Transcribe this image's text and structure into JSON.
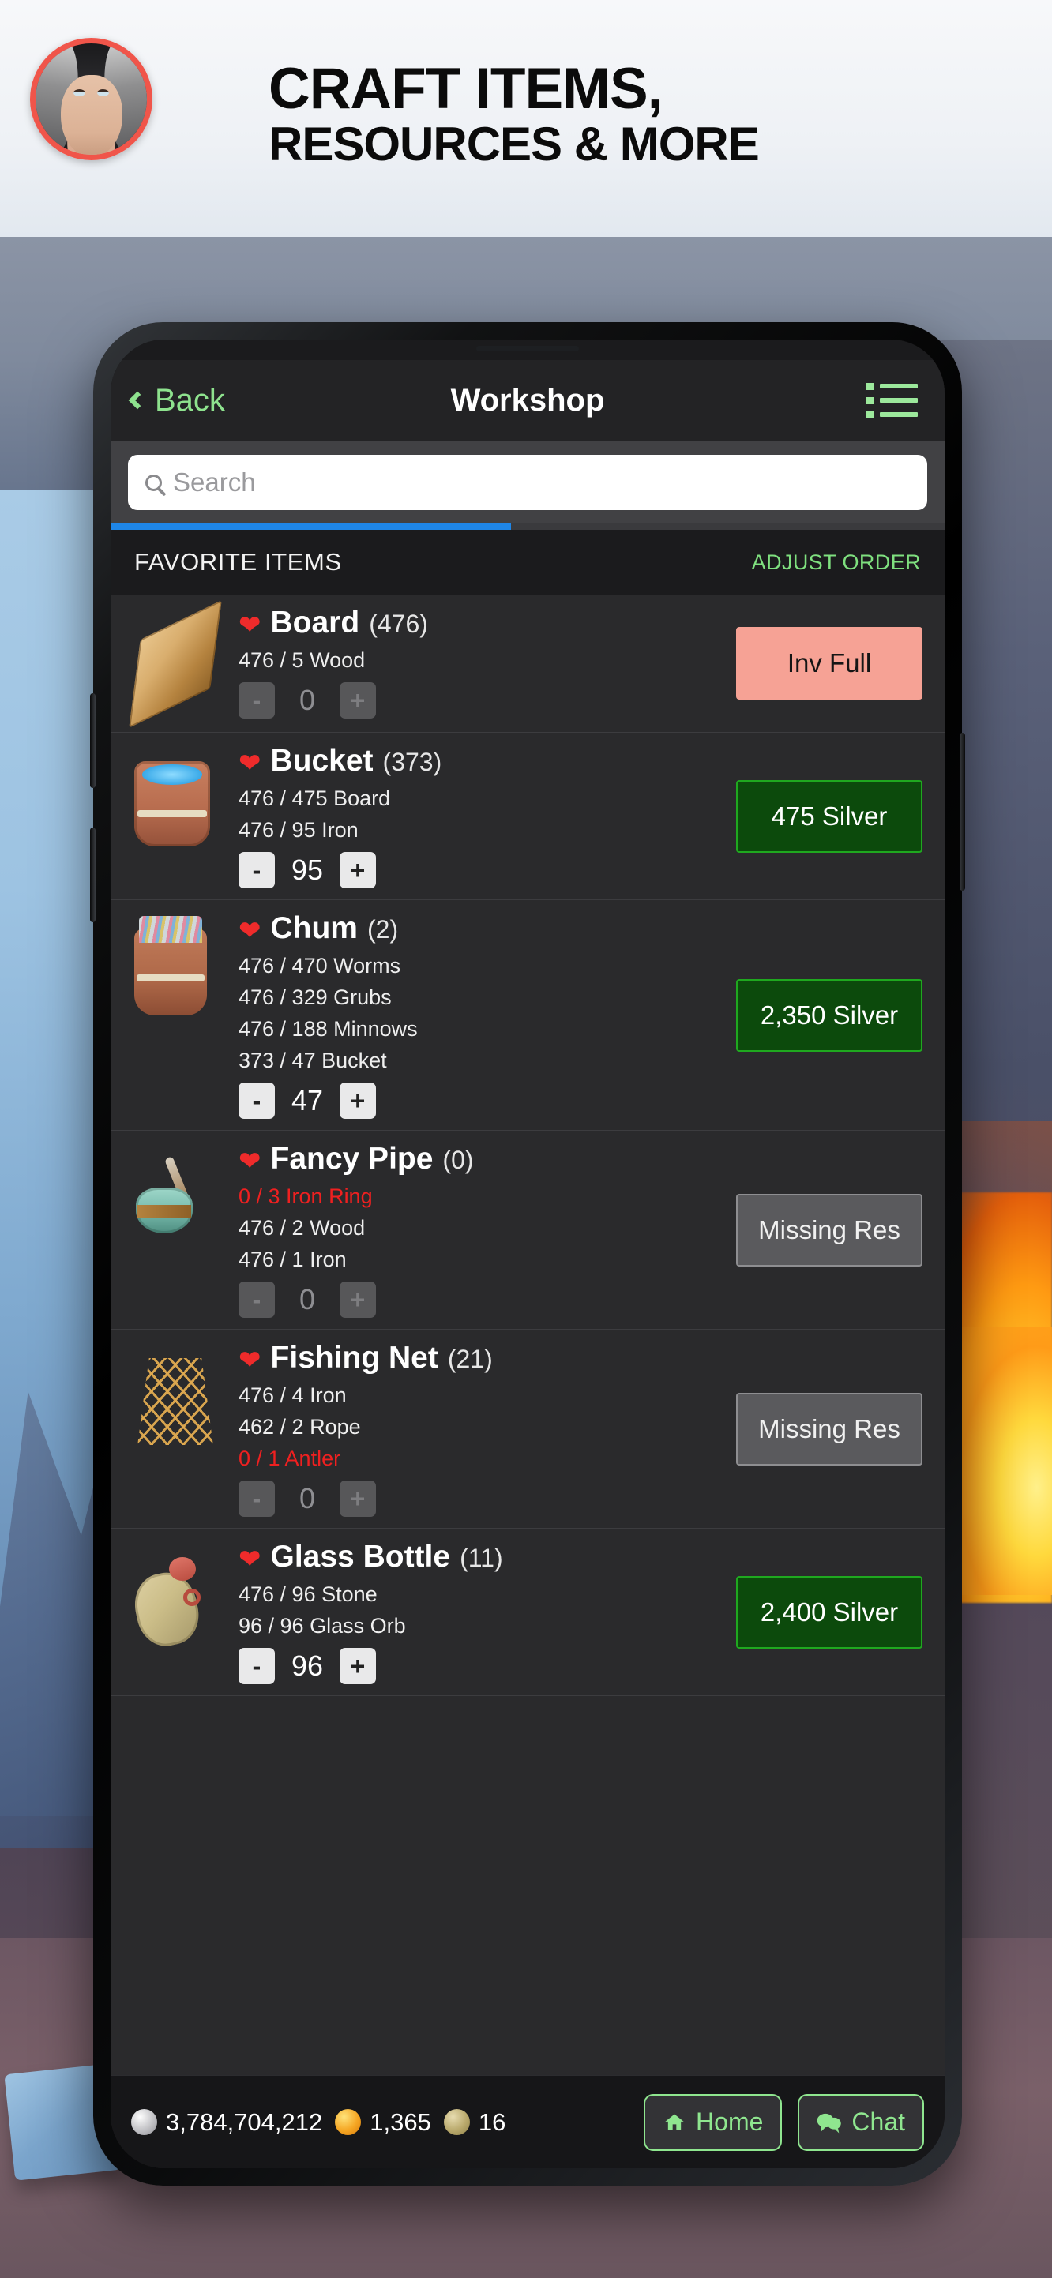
{
  "promo": {
    "headline_line1": "CRAFT ITEMS,",
    "headline_line2": "RESOURCES & MORE",
    "avatar_name": "character-portrait"
  },
  "nav": {
    "back_label": "Back",
    "title": "Workshop",
    "menu_icon": "list-icon"
  },
  "search": {
    "placeholder": "Search",
    "value": "",
    "icon": "search-icon"
  },
  "progress": {
    "percent": 48
  },
  "section": {
    "title": "FAVORITE ITEMS",
    "action_label": "ADJUST ORDER"
  },
  "colors": {
    "accent_green": "#8fe68f",
    "buy_green_bg": "#0c4a0c",
    "buy_green_border": "#1fa81f",
    "inv_full_bg": "#f6a295",
    "missing_bg": "#5a5a5d",
    "missing_text_red": "#ef2020",
    "progress_blue": "#1e86e8",
    "heart_red": "#ef2b2b",
    "promo_accent": "#f0554a"
  },
  "items": [
    {
      "sprite": "board-sprite",
      "favorite_icon": "heart-icon",
      "name": "Board",
      "count": "(476)",
      "requirements": [
        {
          "text": "476 / 5 Wood",
          "missing": false
        }
      ],
      "stepper": {
        "minus": "-",
        "value": "0",
        "plus": "+",
        "enabled": false
      },
      "action": {
        "label": "Inv Full",
        "style": "full"
      }
    },
    {
      "sprite": "bucket-sprite",
      "favorite_icon": "heart-icon",
      "name": "Bucket",
      "count": "(373)",
      "requirements": [
        {
          "text": "476 / 475 Board",
          "missing": false
        },
        {
          "text": "476 / 95 Iron",
          "missing": false
        }
      ],
      "stepper": {
        "minus": "-",
        "value": "95",
        "plus": "+",
        "enabled": true
      },
      "action": {
        "label": "475 Silver",
        "style": "buy"
      }
    },
    {
      "sprite": "chum-sprite",
      "favorite_icon": "heart-icon",
      "name": "Chum",
      "count": "(2)",
      "requirements": [
        {
          "text": "476 / 470 Worms",
          "missing": false
        },
        {
          "text": "476 / 329 Grubs",
          "missing": false
        },
        {
          "text": "476 / 188 Minnows",
          "missing": false
        },
        {
          "text": "373 / 47 Bucket",
          "missing": false
        }
      ],
      "stepper": {
        "minus": "-",
        "value": "47",
        "plus": "+",
        "enabled": true
      },
      "action": {
        "label": "2,350 Silver",
        "style": "buy"
      }
    },
    {
      "sprite": "pipe-sprite",
      "favorite_icon": "heart-icon",
      "name": "Fancy Pipe",
      "count": "(0)",
      "requirements": [
        {
          "text": "0 / 3 Iron Ring",
          "missing": true
        },
        {
          "text": "476 / 2 Wood",
          "missing": false
        },
        {
          "text": "476 / 1 Iron",
          "missing": false
        }
      ],
      "stepper": {
        "minus": "-",
        "value": "0",
        "plus": "+",
        "enabled": false
      },
      "action": {
        "label": "Missing Res",
        "style": "missing"
      }
    },
    {
      "sprite": "net-sprite",
      "favorite_icon": "heart-icon",
      "name": "Fishing Net",
      "count": "(21)",
      "requirements": [
        {
          "text": "476 / 4 Iron",
          "missing": false
        },
        {
          "text": "462 / 2 Rope",
          "missing": false
        },
        {
          "text": "0 / 1 Antler",
          "missing": true
        }
      ],
      "stepper": {
        "minus": "-",
        "value": "0",
        "plus": "+",
        "enabled": false
      },
      "action": {
        "label": "Missing Res",
        "style": "missing"
      }
    },
    {
      "sprite": "bottle-sprite",
      "favorite_icon": "heart-icon",
      "name": "Glass Bottle",
      "count": "(11)",
      "requirements": [
        {
          "text": "476 / 96 Stone",
          "missing": false
        },
        {
          "text": "96 / 96 Glass Orb",
          "missing": false
        }
      ],
      "stepper": {
        "minus": "-",
        "value": "96",
        "plus": "+",
        "enabled": true
      },
      "action": {
        "label": "2,400 Silver",
        "style": "buy"
      }
    }
  ],
  "bottom_bar": {
    "currencies": [
      {
        "icon": "silver-coin-icon",
        "value": "3,784,704,212"
      },
      {
        "icon": "gold-coin-icon",
        "value": "1,365"
      },
      {
        "icon": "bronze-coin-icon",
        "value": "16"
      }
    ],
    "home_label": "Home",
    "home_icon": "home-icon",
    "chat_label": "Chat",
    "chat_icon": "chat-bubble-icon"
  }
}
